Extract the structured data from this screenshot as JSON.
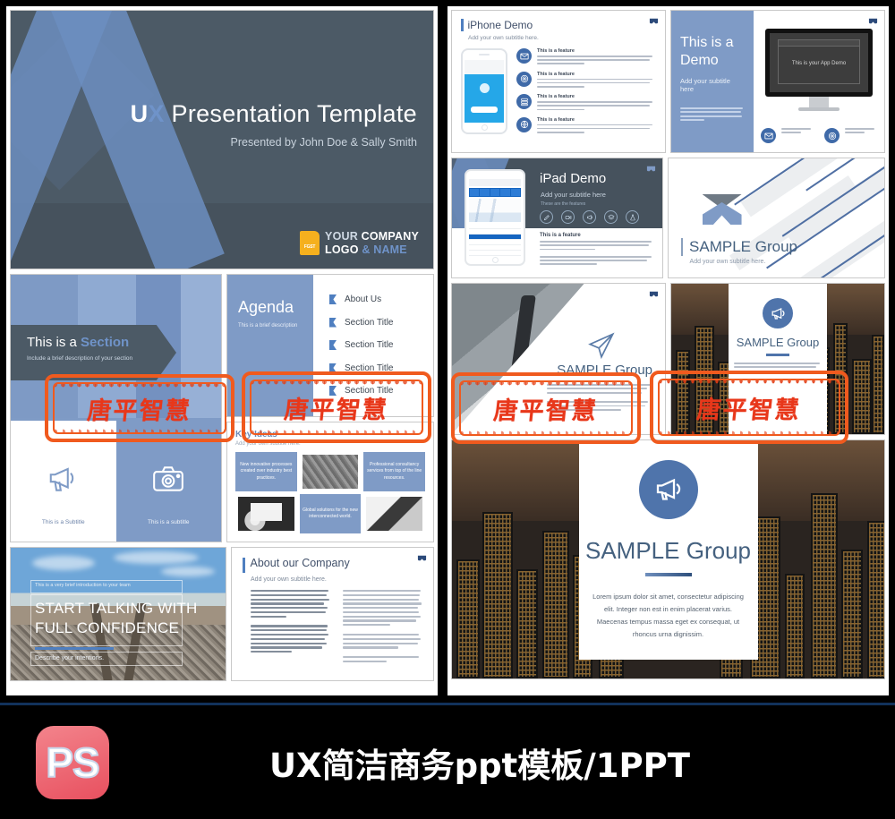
{
  "title_slide": {
    "main_u": "U",
    "main_x": "X",
    "main_rest": " Presentation Template",
    "subtitle": "Presented by John Doe & Sally Smith",
    "logo_mark_text": "FGST",
    "logo_line1_a": "YOUR ",
    "logo_line1_b": "COMPANY",
    "logo_line2_a": "LOGO ",
    "logo_line2_b": "& NAME"
  },
  "section_slide": {
    "title_plain": "This is a ",
    "title_bold": "Section",
    "subtitle": "Include a brief description of your section",
    "cells": [
      {
        "icon": "megaphone-icon",
        "caption": "This is a Subtitle"
      },
      {
        "icon": "camera-icon",
        "caption": "This is a subtitle"
      }
    ]
  },
  "agenda_slide": {
    "title": "Agenda",
    "subtitle": "This is a brief description",
    "items": [
      "About Us",
      "Section Title",
      "Section Title",
      "Section Title",
      "Section Title"
    ]
  },
  "ideas_slide": {
    "title": "Key Ideas",
    "subtitle": "Add your own subtitle here.",
    "cells": [
      {
        "kind": "text",
        "text": "New innovative processes created over industry best practices."
      },
      {
        "kind": "image",
        "image": "aerial-photo"
      },
      {
        "kind": "text",
        "text": "Professional consultancy services from top of the line resources."
      },
      {
        "kind": "image",
        "image": "whiteboard-photo"
      },
      {
        "kind": "text",
        "text": "Global solutions for the new interconnected world."
      },
      {
        "kind": "image",
        "image": "laptop-photo"
      }
    ]
  },
  "rail_slide": {
    "eyebrow": "This is a very brief introduction to your team",
    "headline_line1": "START TALKING WITH",
    "headline_line2": "FULL CONFIDENCE",
    "describe": "Describe your intentions."
  },
  "about_slide": {
    "title": "About our Company",
    "subtitle": "Add your own subtitle here."
  },
  "iphone_slide": {
    "title": "iPhone Demo",
    "subtitle": "Add your own subtitle here.",
    "features": [
      {
        "icon": "envelope-icon",
        "heading": "This is a feature"
      },
      {
        "icon": "fingerprint-icon",
        "heading": "This is a feature"
      },
      {
        "icon": "server-icon",
        "heading": "This is a feature"
      },
      {
        "icon": "globe-icon",
        "heading": "This is a feature"
      }
    ]
  },
  "demo_slide": {
    "title_line1": "This is a",
    "title_line2": "Demo",
    "subtitle": "Add your subtitle here",
    "screen_label": "This is your App Demo",
    "bottom_features": [
      {
        "icon": "envelope-icon"
      },
      {
        "icon": "fingerprint-icon"
      }
    ]
  },
  "ipad_slide": {
    "title": "iPad Demo",
    "subtitle": "Add your subtitle here",
    "subtitle2": "These are the features",
    "icons": [
      "pen-icon",
      "video-icon",
      "megaphone-icon",
      "layers-icon",
      "flask-icon"
    ],
    "feature_heading": "This is a feature"
  },
  "sample1_slide": {
    "logo": "x-logo-icon",
    "title_a": "SAMPLE",
    "title_b": " Group",
    "subtitle": "Add your own subtitle here."
  },
  "sample2_slide": {
    "icon": "paper-plane-icon",
    "title_a": "SAMPLE",
    "title_b": " Group"
  },
  "city_slide": {
    "icon": "megaphone-icon",
    "title_a": "SAMPLE",
    "title_b": " Group"
  },
  "city_big_slide": {
    "icon": "megaphone-icon",
    "title_a": "SAMPLE",
    "title_b": " Group",
    "paragraph": "Lorem ipsum dolor sit amet, consectetur adipiscing elit. Integer non est in enim placerat varius. Maecenas tempus massa eget ex consequat, ut rhoncus urna dignissim."
  },
  "watermark": {
    "text": "唐平智慧",
    "color": "#f05a1e"
  },
  "bottom_bar": {
    "badge": "PS",
    "title": "UX简洁商务ppt模板/1PPT"
  }
}
